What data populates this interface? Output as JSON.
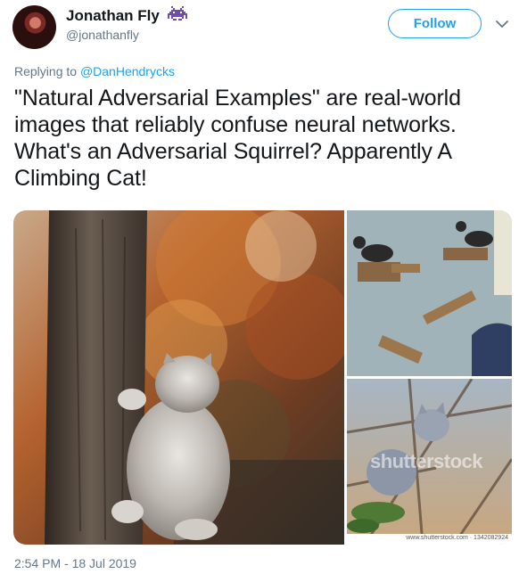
{
  "author": {
    "display_name": "Jonathan Fly",
    "handle": "@jonathanfly",
    "avatar_icon": "avatar-photo",
    "badge_icon": "space-invader-icon"
  },
  "actions": {
    "follow_label": "Follow",
    "menu_icon": "chevron-down-icon"
  },
  "reply": {
    "prefix": "Replying to ",
    "mention": "@DanHendrycks"
  },
  "tweet": {
    "text": "\"Natural Adversarial Examples\" are real-world images that reliably confuse neural networks. What's an Adversarial Squirrel? Apparently A Climbing Cat!"
  },
  "media": {
    "watermark": "shutterstock",
    "stock_caption": "www.shutterstock.com · 1342082924"
  },
  "timestamp": "2:54 PM - 18 Jul 2019",
  "colors": {
    "accent": "#1da1f2",
    "secondary_text": "#657786",
    "primary_text": "#14171a"
  }
}
